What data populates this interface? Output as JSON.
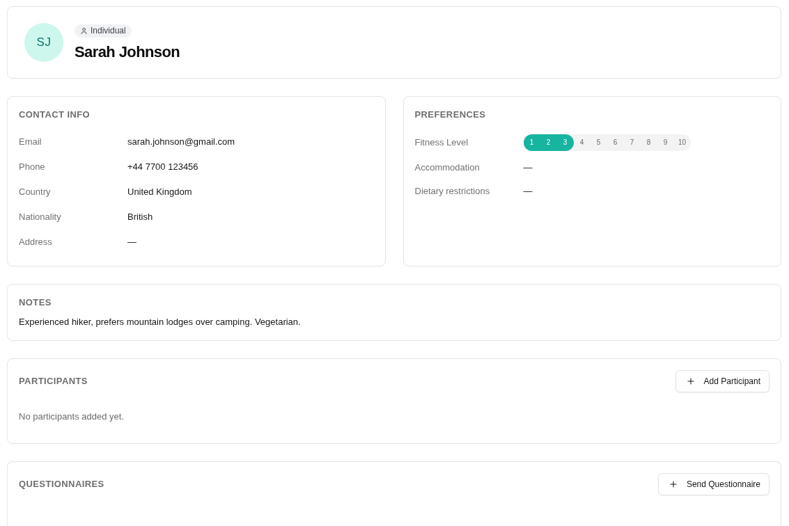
{
  "profile": {
    "initials": "SJ",
    "type_badge": "Individual",
    "name": "Sarah Johnson"
  },
  "contact_info": {
    "title": "CONTACT INFO",
    "fields": [
      {
        "label": "Email",
        "value": "sarah.johnson@gmail.com"
      },
      {
        "label": "Phone",
        "value": "+44 7700 123456"
      },
      {
        "label": "Country",
        "value": "United Kingdom"
      },
      {
        "label": "Nationality",
        "value": "British"
      },
      {
        "label": "Address",
        "value": "—"
      }
    ]
  },
  "preferences": {
    "title": "PREFERENCES",
    "fields": [
      {
        "kind": "scale",
        "label": "Fitness Level",
        "steps": [
          "1",
          "2",
          "3",
          "4",
          "5",
          "6",
          "7",
          "8",
          "9",
          "10"
        ],
        "level": 0.3
      },
      {
        "kind": "text",
        "label": "Accommodation",
        "value": "—"
      },
      {
        "kind": "text",
        "label": "Dietary restrictions",
        "value": "—"
      }
    ]
  },
  "notes": {
    "title": "NOTES",
    "text": "Experienced hiker, prefers mountain lodges over camping. Vegetarian."
  },
  "participants": {
    "title": "PARTICIPANTS",
    "button": "Add Participant",
    "empty_text": "No participants added yet."
  },
  "questionnaires": {
    "title": "QUESTIONNAIRES",
    "button": "Send Questionnaire"
  }
}
